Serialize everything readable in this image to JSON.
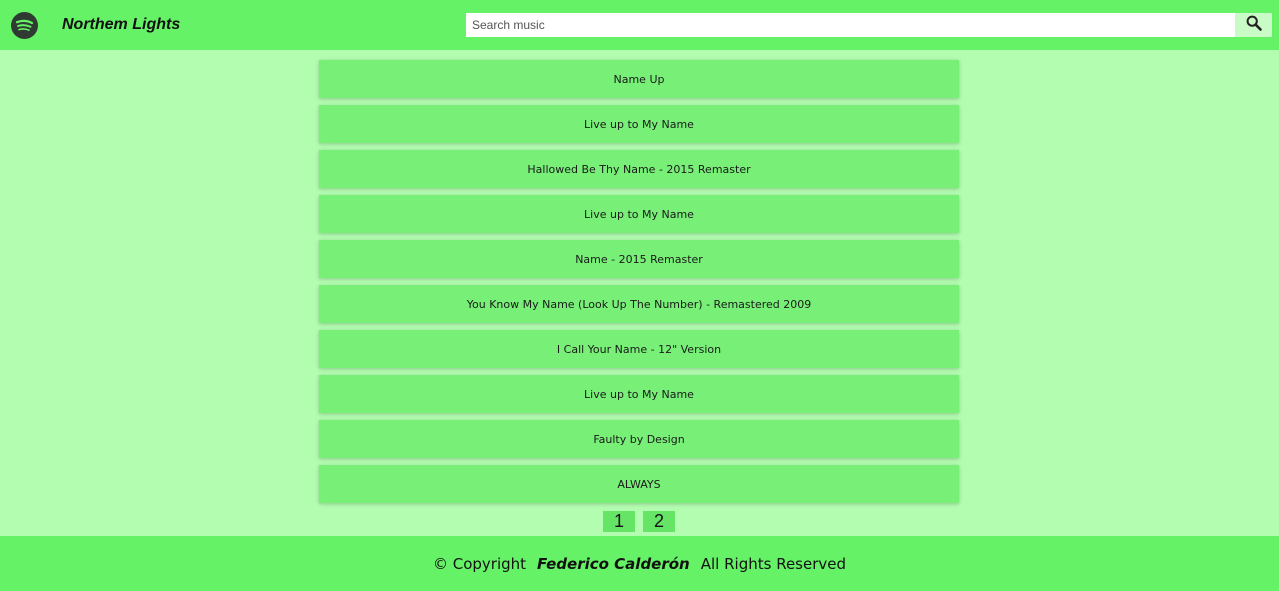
{
  "header": {
    "title": "Northem Lights",
    "logo_icon": "spotify-logo-icon",
    "search_placeholder": "Search music",
    "search_value": "",
    "search_icon": "search-icon"
  },
  "tracks": [
    "Name Up",
    "Live up to My Name",
    "Hallowed Be Thy Name - 2015 Remaster",
    "Live up to My Name",
    "Name - 2015 Remaster",
    "You Know My Name (Look Up The Number) - Remastered 2009",
    "I Call Your Name - 12\" Version",
    "Live up to My Name",
    "Faulty by Design",
    "ALWAYS"
  ],
  "pagination": [
    "1",
    "2"
  ],
  "footer": {
    "prefix": "© Copyright",
    "author": "Federico Calderón",
    "suffix": "All Rights Reserved"
  },
  "colors": {
    "background": "#b3fdb1",
    "header": "#66f266",
    "track": "#78f078",
    "page_button": "#66e466"
  }
}
